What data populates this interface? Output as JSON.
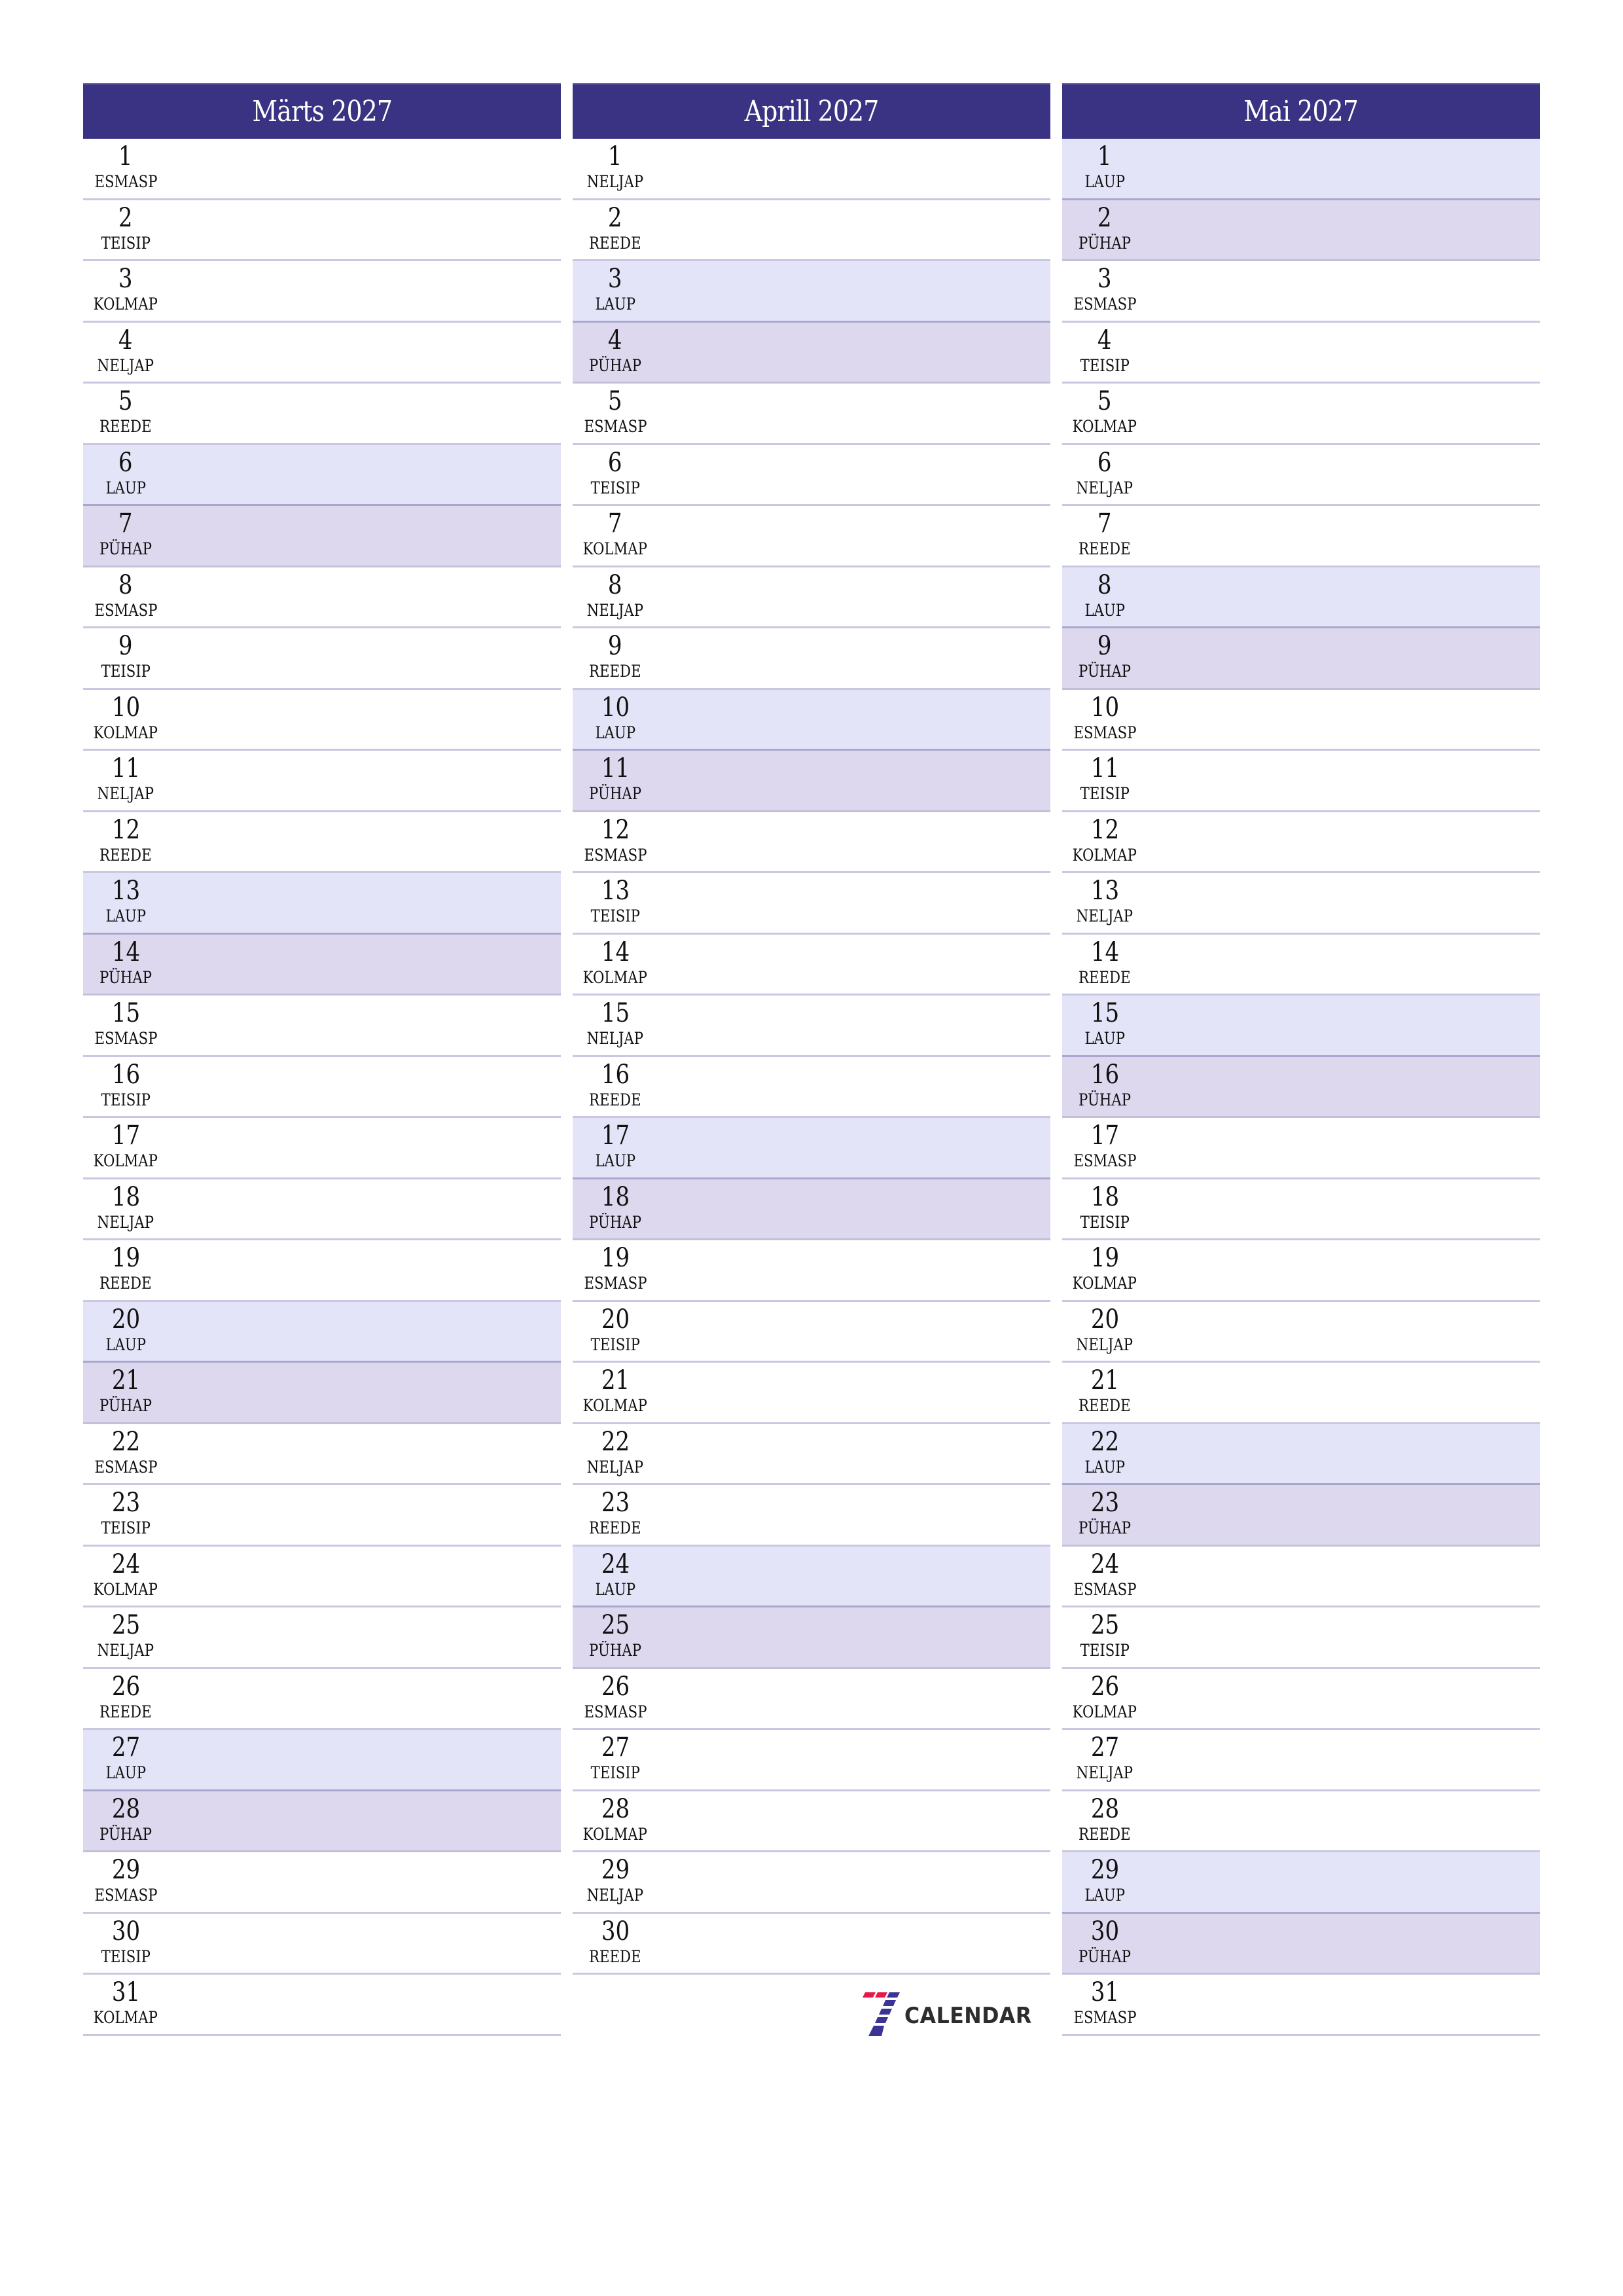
{
  "colors": {
    "header": "#3a3283",
    "saturday": "#e4e4f8",
    "sunday": "#ddd8ee",
    "logo_red": "#e8194a",
    "logo_blue": "#3b3496"
  },
  "months": [
    {
      "title": "Märts 2027",
      "days": [
        {
          "n": "1",
          "w": "ESMASP",
          "t": ""
        },
        {
          "n": "2",
          "w": "TEISIP",
          "t": ""
        },
        {
          "n": "3",
          "w": "KOLMAP",
          "t": ""
        },
        {
          "n": "4",
          "w": "NELJAP",
          "t": ""
        },
        {
          "n": "5",
          "w": "REEDE",
          "t": ""
        },
        {
          "n": "6",
          "w": "LAUP",
          "t": "sat"
        },
        {
          "n": "7",
          "w": "PÜHAP",
          "t": "sun"
        },
        {
          "n": "8",
          "w": "ESMASP",
          "t": ""
        },
        {
          "n": "9",
          "w": "TEISIP",
          "t": ""
        },
        {
          "n": "10",
          "w": "KOLMAP",
          "t": ""
        },
        {
          "n": "11",
          "w": "NELJAP",
          "t": ""
        },
        {
          "n": "12",
          "w": "REEDE",
          "t": ""
        },
        {
          "n": "13",
          "w": "LAUP",
          "t": "sat"
        },
        {
          "n": "14",
          "w": "PÜHAP",
          "t": "sun"
        },
        {
          "n": "15",
          "w": "ESMASP",
          "t": ""
        },
        {
          "n": "16",
          "w": "TEISIP",
          "t": ""
        },
        {
          "n": "17",
          "w": "KOLMAP",
          "t": ""
        },
        {
          "n": "18",
          "w": "NELJAP",
          "t": ""
        },
        {
          "n": "19",
          "w": "REEDE",
          "t": ""
        },
        {
          "n": "20",
          "w": "LAUP",
          "t": "sat"
        },
        {
          "n": "21",
          "w": "PÜHAP",
          "t": "sun"
        },
        {
          "n": "22",
          "w": "ESMASP",
          "t": ""
        },
        {
          "n": "23",
          "w": "TEISIP",
          "t": ""
        },
        {
          "n": "24",
          "w": "KOLMAP",
          "t": ""
        },
        {
          "n": "25",
          "w": "NELJAP",
          "t": ""
        },
        {
          "n": "26",
          "w": "REEDE",
          "t": ""
        },
        {
          "n": "27",
          "w": "LAUP",
          "t": "sat"
        },
        {
          "n": "28",
          "w": "PÜHAP",
          "t": "sun"
        },
        {
          "n": "29",
          "w": "ESMASP",
          "t": ""
        },
        {
          "n": "30",
          "w": "TEISIP",
          "t": ""
        },
        {
          "n": "31",
          "w": "KOLMAP",
          "t": ""
        }
      ]
    },
    {
      "title": "Aprill 2027",
      "days": [
        {
          "n": "1",
          "w": "NELJAP",
          "t": ""
        },
        {
          "n": "2",
          "w": "REEDE",
          "t": ""
        },
        {
          "n": "3",
          "w": "LAUP",
          "t": "sat"
        },
        {
          "n": "4",
          "w": "PÜHAP",
          "t": "sun"
        },
        {
          "n": "5",
          "w": "ESMASP",
          "t": ""
        },
        {
          "n": "6",
          "w": "TEISIP",
          "t": ""
        },
        {
          "n": "7",
          "w": "KOLMAP",
          "t": ""
        },
        {
          "n": "8",
          "w": "NELJAP",
          "t": ""
        },
        {
          "n": "9",
          "w": "REEDE",
          "t": ""
        },
        {
          "n": "10",
          "w": "LAUP",
          "t": "sat"
        },
        {
          "n": "11",
          "w": "PÜHAP",
          "t": "sun"
        },
        {
          "n": "12",
          "w": "ESMASP",
          "t": ""
        },
        {
          "n": "13",
          "w": "TEISIP",
          "t": ""
        },
        {
          "n": "14",
          "w": "KOLMAP",
          "t": ""
        },
        {
          "n": "15",
          "w": "NELJAP",
          "t": ""
        },
        {
          "n": "16",
          "w": "REEDE",
          "t": ""
        },
        {
          "n": "17",
          "w": "LAUP",
          "t": "sat"
        },
        {
          "n": "18",
          "w": "PÜHAP",
          "t": "sun"
        },
        {
          "n": "19",
          "w": "ESMASP",
          "t": ""
        },
        {
          "n": "20",
          "w": "TEISIP",
          "t": ""
        },
        {
          "n": "21",
          "w": "KOLMAP",
          "t": ""
        },
        {
          "n": "22",
          "w": "NELJAP",
          "t": ""
        },
        {
          "n": "23",
          "w": "REEDE",
          "t": ""
        },
        {
          "n": "24",
          "w": "LAUP",
          "t": "sat"
        },
        {
          "n": "25",
          "w": "PÜHAP",
          "t": "sun"
        },
        {
          "n": "26",
          "w": "ESMASP",
          "t": ""
        },
        {
          "n": "27",
          "w": "TEISIP",
          "t": ""
        },
        {
          "n": "28",
          "w": "KOLMAP",
          "t": ""
        },
        {
          "n": "29",
          "w": "NELJAP",
          "t": ""
        },
        {
          "n": "30",
          "w": "REEDE",
          "t": ""
        }
      ]
    },
    {
      "title": "Mai 2027",
      "days": [
        {
          "n": "1",
          "w": "LAUP",
          "t": "sat"
        },
        {
          "n": "2",
          "w": "PÜHAP",
          "t": "sun"
        },
        {
          "n": "3",
          "w": "ESMASP",
          "t": ""
        },
        {
          "n": "4",
          "w": "TEISIP",
          "t": ""
        },
        {
          "n": "5",
          "w": "KOLMAP",
          "t": ""
        },
        {
          "n": "6",
          "w": "NELJAP",
          "t": ""
        },
        {
          "n": "7",
          "w": "REEDE",
          "t": ""
        },
        {
          "n": "8",
          "w": "LAUP",
          "t": "sat"
        },
        {
          "n": "9",
          "w": "PÜHAP",
          "t": "sun"
        },
        {
          "n": "10",
          "w": "ESMASP",
          "t": ""
        },
        {
          "n": "11",
          "w": "TEISIP",
          "t": ""
        },
        {
          "n": "12",
          "w": "KOLMAP",
          "t": ""
        },
        {
          "n": "13",
          "w": "NELJAP",
          "t": ""
        },
        {
          "n": "14",
          "w": "REEDE",
          "t": ""
        },
        {
          "n": "15",
          "w": "LAUP",
          "t": "sat"
        },
        {
          "n": "16",
          "w": "PÜHAP",
          "t": "sun"
        },
        {
          "n": "17",
          "w": "ESMASP",
          "t": ""
        },
        {
          "n": "18",
          "w": "TEISIP",
          "t": ""
        },
        {
          "n": "19",
          "w": "KOLMAP",
          "t": ""
        },
        {
          "n": "20",
          "w": "NELJAP",
          "t": ""
        },
        {
          "n": "21",
          "w": "REEDE",
          "t": ""
        },
        {
          "n": "22",
          "w": "LAUP",
          "t": "sat"
        },
        {
          "n": "23",
          "w": "PÜHAP",
          "t": "sun"
        },
        {
          "n": "24",
          "w": "ESMASP",
          "t": ""
        },
        {
          "n": "25",
          "w": "TEISIP",
          "t": ""
        },
        {
          "n": "26",
          "w": "KOLMAP",
          "t": ""
        },
        {
          "n": "27",
          "w": "NELJAP",
          "t": ""
        },
        {
          "n": "28",
          "w": "REEDE",
          "t": ""
        },
        {
          "n": "29",
          "w": "LAUP",
          "t": "sat"
        },
        {
          "n": "30",
          "w": "PÜHAP",
          "t": "sun"
        },
        {
          "n": "31",
          "w": "ESMASP",
          "t": ""
        }
      ]
    }
  ],
  "logo": {
    "text": "CALENDAR",
    "icon": "seven-logo-icon"
  }
}
